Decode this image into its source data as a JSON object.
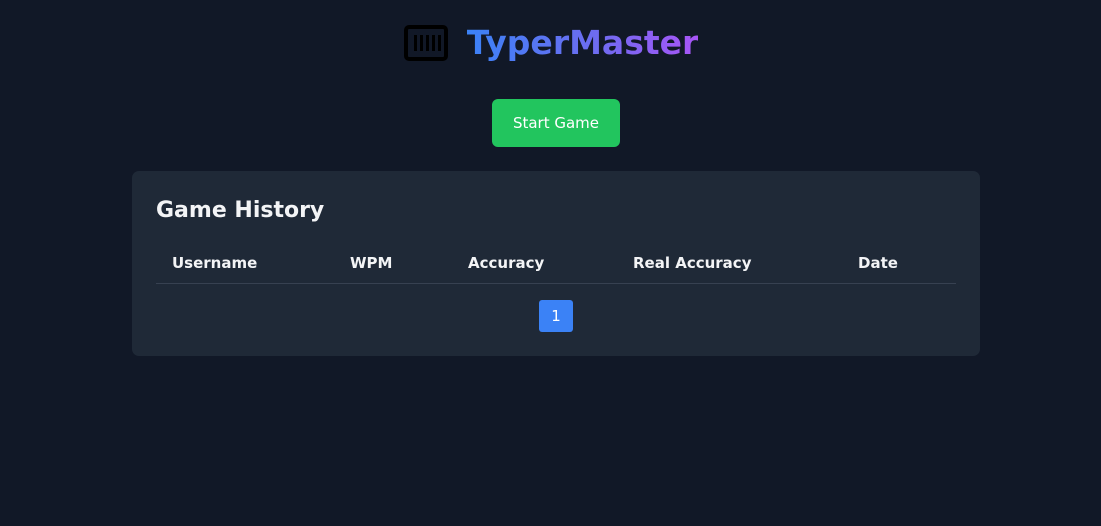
{
  "header": {
    "title": "TyperMaster",
    "logo_icon": "keyboard-icon",
    "title_gradient": [
      "#3b82f6",
      "#a855f7"
    ]
  },
  "actions": {
    "start_label": "Start Game",
    "start_color": "#22c55e"
  },
  "history": {
    "title": "Game History",
    "columns": [
      "Username",
      "WPM",
      "Accuracy",
      "Real Accuracy",
      "Date"
    ],
    "rows": []
  },
  "pagination": {
    "current_page": "1",
    "active_color": "#3b82f6"
  },
  "theme": {
    "background": "#111827",
    "panel": "#1f2937"
  }
}
